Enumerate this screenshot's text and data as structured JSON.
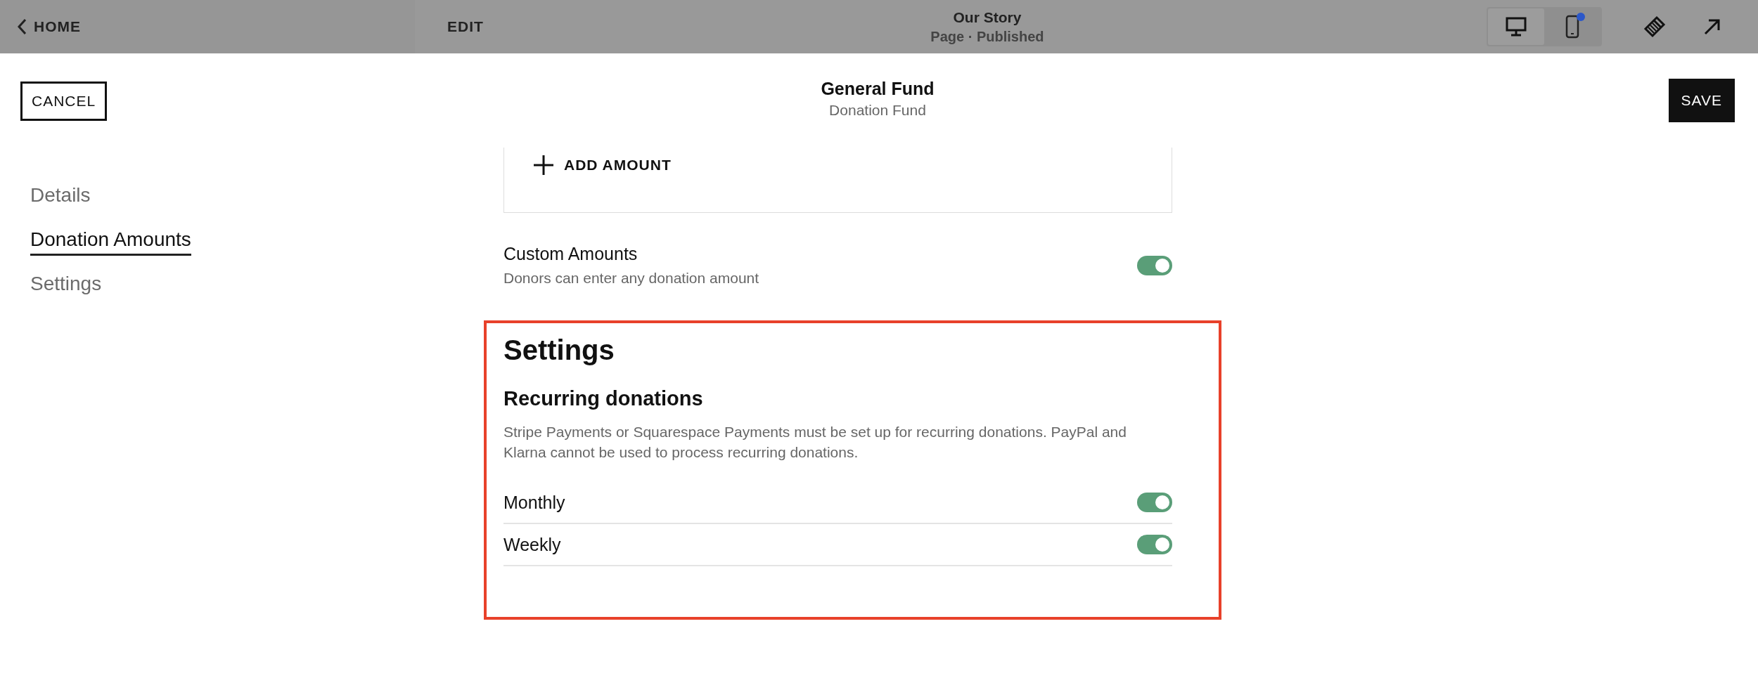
{
  "top_bar": {
    "home": "HOME",
    "edit": "EDIT",
    "page_title": "Our Story",
    "page_status": "Page · Published",
    "devices": [
      {
        "kind": "desktop",
        "selected": true
      },
      {
        "kind": "mobile",
        "selected": false
      }
    ]
  },
  "header": {
    "cancel": "CANCEL",
    "title": "General Fund",
    "subtitle": "Donation Fund",
    "save": "SAVE"
  },
  "nav": [
    {
      "label": "Details",
      "selected": false
    },
    {
      "label": "Donation Amounts",
      "selected": true
    },
    {
      "label": "Settings",
      "selected": false
    }
  ],
  "add_amount": "ADD AMOUNT",
  "custom_amounts": {
    "label": "Custom Amounts",
    "description": "Donors can enter any donation amount",
    "on": true
  },
  "settings": {
    "heading": "Settings",
    "subheading": "Recurring donations",
    "description": "Stripe Payments or Squarespace Payments must be set up for recurring donations. PayPal and Klarna cannot be used to process recurring donations.",
    "options": [
      {
        "label": "Monthly",
        "on": true
      },
      {
        "label": "Weekly",
        "on": true
      }
    ]
  }
}
